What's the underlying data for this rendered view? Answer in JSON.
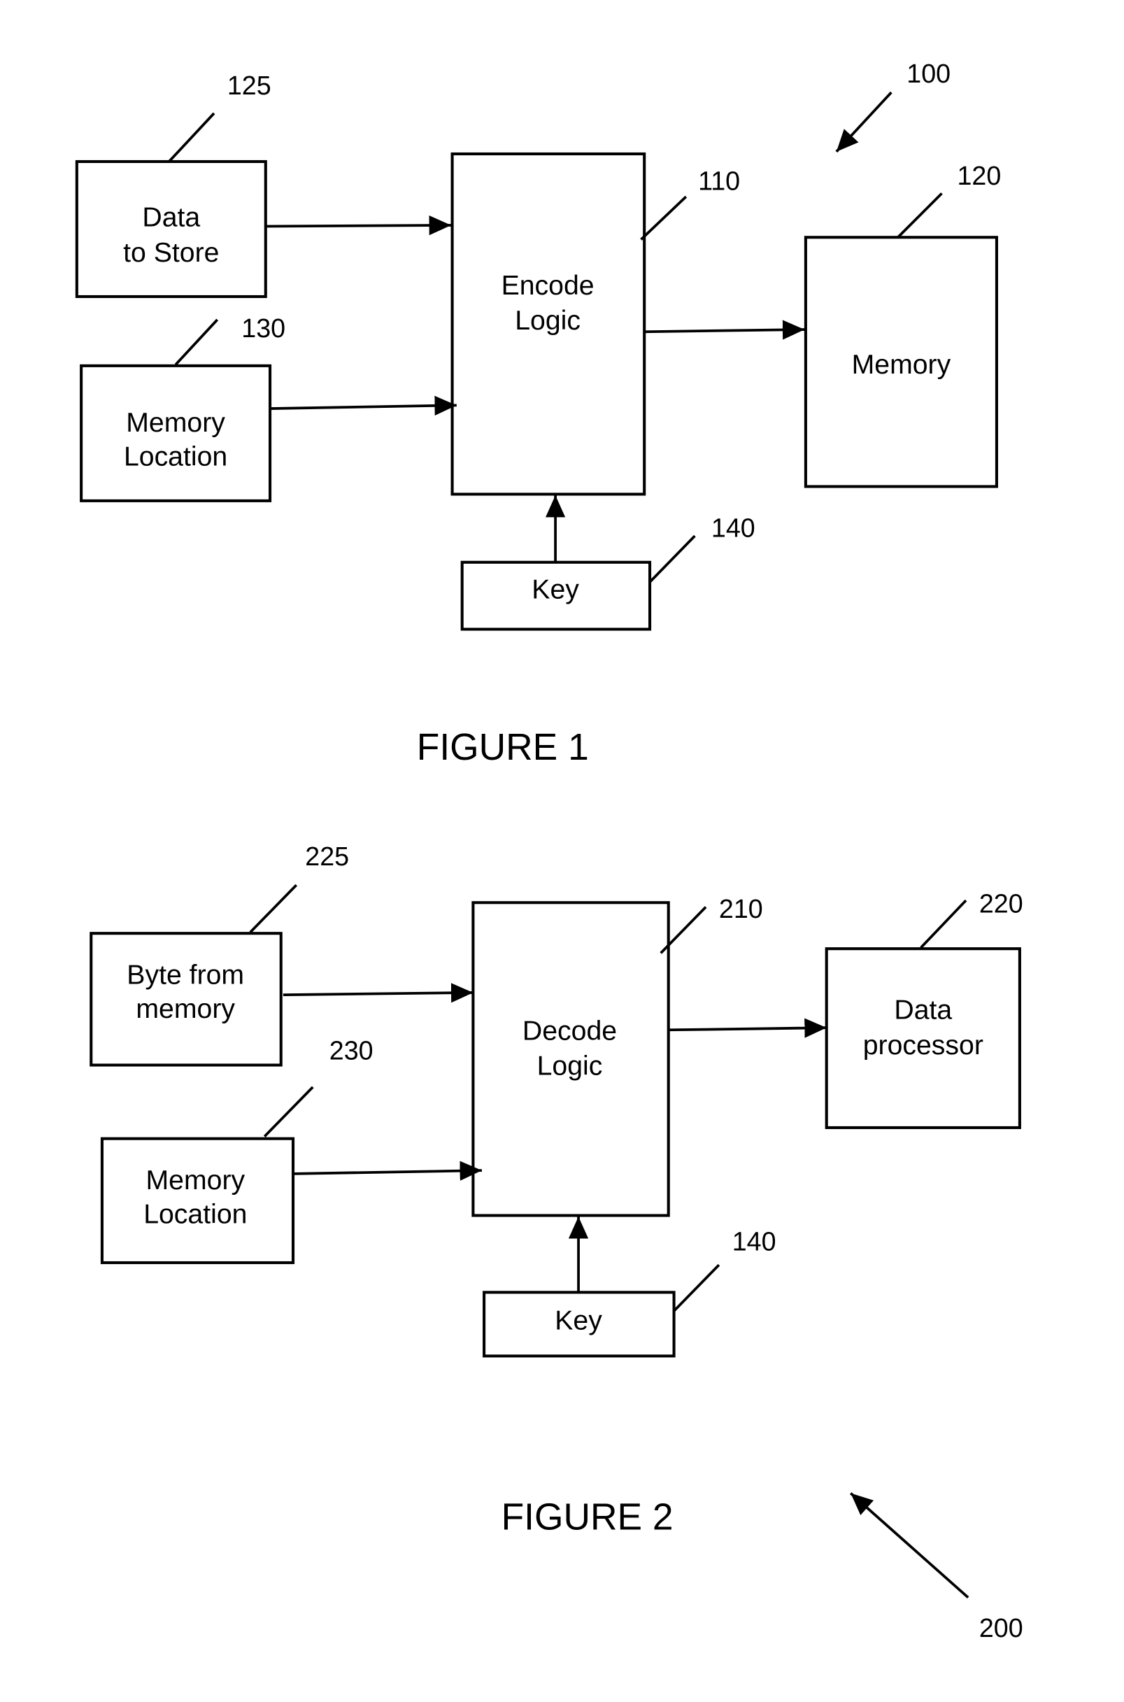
{
  "figure1": {
    "caption": "FIGURE 1",
    "figure_ref": "100",
    "blocks": {
      "data_to_store": {
        "line1": "Data",
        "line2": "to Store",
        "ref": "125"
      },
      "memory_location": {
        "line1": "Memory",
        "line2": "Location",
        "ref": "130"
      },
      "encode_logic": {
        "line1": "Encode",
        "line2": "Logic",
        "ref": "110"
      },
      "memory": {
        "line1": "Memory",
        "ref": "120"
      },
      "key": {
        "line1": "Key",
        "ref": "140"
      }
    }
  },
  "figure2": {
    "caption": "FIGURE 2",
    "figure_ref": "200",
    "blocks": {
      "byte_from_memory": {
        "line1": "Byte from",
        "line2": "memory",
        "ref": "225"
      },
      "memory_location": {
        "line1": "Memory",
        "line2": "Location",
        "ref": "230"
      },
      "decode_logic": {
        "line1": "Decode",
        "line2": "Logic",
        "ref": "210"
      },
      "data_processor": {
        "line1": "Data",
        "line2": "processor",
        "ref": "220"
      },
      "key": {
        "line1": "Key",
        "ref": "140"
      }
    }
  }
}
